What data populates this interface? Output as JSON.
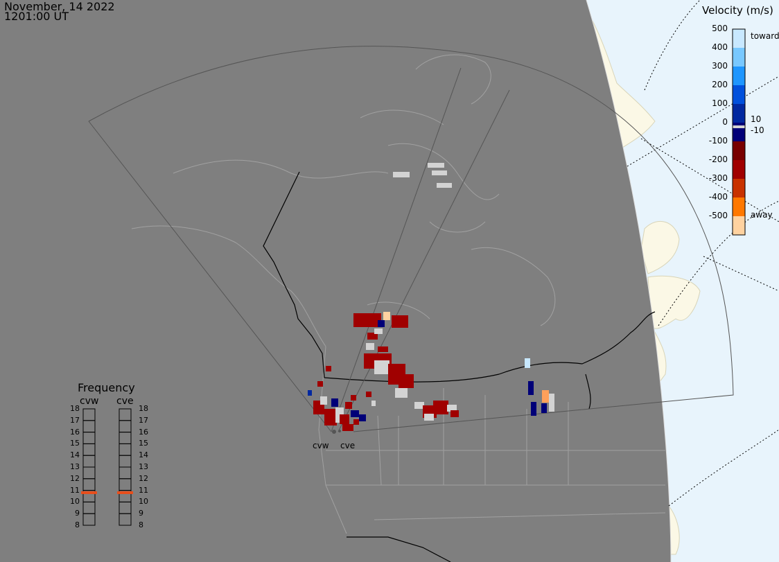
{
  "header": {
    "date": "November, 14 2022",
    "time": "1201:00 UT"
  },
  "velocity_legend": {
    "title": "Velocity (m/s)",
    "ticks": [
      "500",
      "400",
      "300",
      "200",
      "100",
      "0",
      "-100",
      "-200",
      "-300",
      "-400",
      "-500"
    ],
    "toward_label": "toward",
    "away_label": "away",
    "near_zero_pos": "10",
    "near_zero_neg": "-10",
    "colors": [
      "#c8e8ff",
      "#78c8ff",
      "#1e96ff",
      "#0050dc",
      "#0028a0",
      "#000078",
      "#780000",
      "#a00000",
      "#c83200",
      "#ff7800",
      "#ffd2a0"
    ]
  },
  "frequency_panel": {
    "title": "Frequency",
    "columns": [
      "cvw",
      "cve"
    ],
    "levels": [
      "18",
      "17",
      "16",
      "15",
      "14",
      "13",
      "12",
      "11",
      "10",
      "9",
      "8"
    ],
    "cvw_value_mhz": 10.8,
    "cve_value_mhz": 10.8,
    "indicator_color": "#e84e1b"
  },
  "radars": {
    "west_label": "cvw",
    "east_label": "cve"
  },
  "colors": {
    "land_night": "#7f7f7f",
    "ocean_day": "#e8f4fc",
    "land_day": "#fbf8e6",
    "border": "#000000",
    "coast": "#b0b0b0",
    "ground_scatter": "#d3d3d3"
  }
}
